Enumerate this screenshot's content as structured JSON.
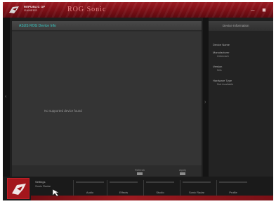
{
  "window": {
    "brand_line1": "REPUBLIC OF",
    "brand_line2": "GAMERS",
    "title": "ROG Sonic",
    "minimize_glyph": "–",
    "close_glyph": "■"
  },
  "main": {
    "header": "ASUS ROG Device Info",
    "empty_message": "No supported device found",
    "footer_buttons": [
      {
        "label": "Refresh"
      },
      {
        "label": "Apply"
      }
    ]
  },
  "sidebar": {
    "title": "Device Information",
    "rows": [
      {
        "key": "Device Name",
        "value": ""
      },
      {
        "key": "Manufacturer",
        "value": "Unknown"
      },
      {
        "key": "Version",
        "value": "N/A"
      },
      {
        "key": "Hardware Type",
        "value": "Not Available"
      }
    ]
  },
  "bottom_bar": {
    "active_item": {
      "label": "Settings",
      "sublabel": "Sonic Radar"
    },
    "nav_items": [
      {
        "label": "Audio"
      },
      {
        "label": "Effects"
      },
      {
        "label": "Studio"
      },
      {
        "label": "Sonic Radar"
      },
      {
        "label": "Profile"
      }
    ]
  },
  "icons": {
    "logo": "rog-eye-icon",
    "badge": "rog-eye-icon",
    "cursor": "mouse-pointer-icon",
    "left_grip": "chevron-left-icon",
    "right_grip": "chevron-right-icon"
  },
  "colors": {
    "titlebar": "#7a0f16",
    "accent": "#9d1a20",
    "header_text": "#39c9c4",
    "panel": "#343434"
  }
}
